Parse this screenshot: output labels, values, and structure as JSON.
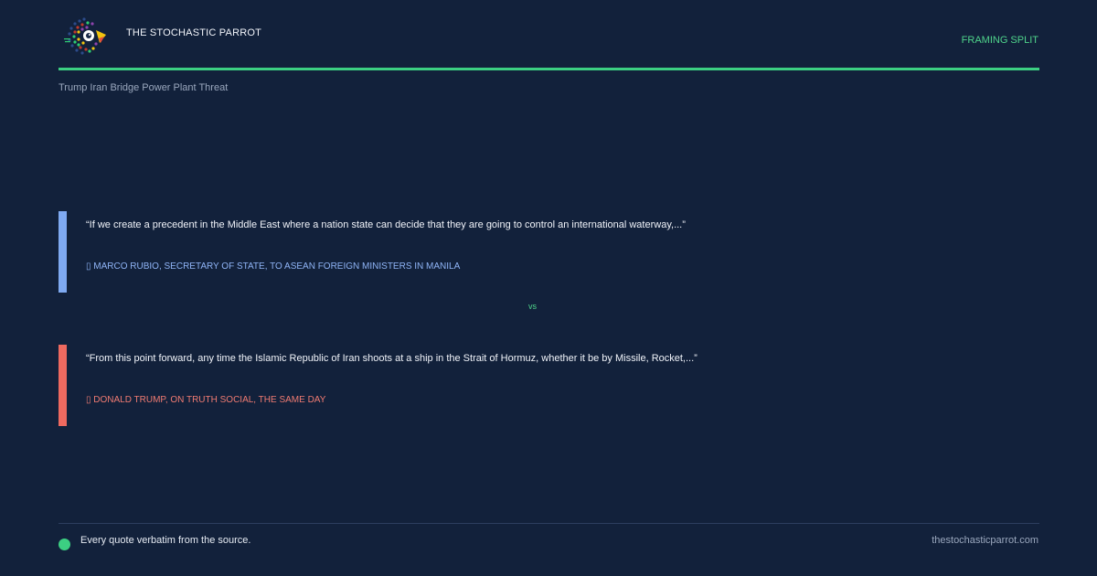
{
  "header": {
    "brand": "THE STOCHASTIC PARROT",
    "tag": "FRAMING SPLIT",
    "subtitle": "Trump Iran Bridge Power Plant Threat",
    "logo_icon": "parrot-dots-logo"
  },
  "quotes": [
    {
      "text": "“If we create a precedent in the Middle East where a nation state can decide that they are going to control an international waterway,...”",
      "attribution": "▯ MARCO RUBIO, SECRETARY OF STATE, TO ASEAN FOREIGN MINISTERS IN MANILA",
      "accent": "#7faaf2"
    },
    {
      "text": "“From this point forward, any time the Islamic Republic of Iran shoots at a ship in the Strait of Hormuz, whether it be by Missile, Rocket,...”",
      "attribution": "▯ DONALD TRUMP, ON TRUTH SOCIAL, THE SAME DAY",
      "accent": "#ef6a60"
    }
  ],
  "divider": {
    "label": "vs"
  },
  "footer": {
    "note": "Every quote verbatim from the source.",
    "url": "thestochasticparrot.com"
  },
  "colors": {
    "background": "#12213b",
    "accent_green": "#3ccf82"
  }
}
